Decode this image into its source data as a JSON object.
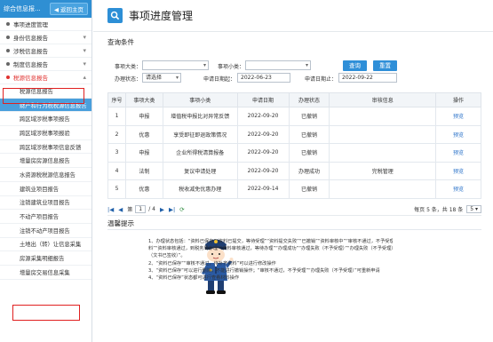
{
  "sidebar": {
    "title": "综合信息报...",
    "back_label": "返回主页",
    "groups": [
      {
        "label": "事项进度管理"
      },
      {
        "label": "身份信息报告"
      },
      {
        "label": "涉税信息报告"
      },
      {
        "label": "制度信息报告"
      }
    ],
    "active_group": {
      "label": "税源信息报告"
    },
    "sub_items": [
      {
        "label": "税源信息报告"
      },
      {
        "label": "财产和行为税税源信息报告"
      },
      {
        "label": "跨区域涉税事项报告"
      },
      {
        "label": "跨区域涉税事项报验"
      },
      {
        "label": "跨区域涉税事项信息反馈"
      },
      {
        "label": "增量房房源信息报告"
      },
      {
        "label": "水资源税税源信息报告"
      },
      {
        "label": "建筑业项目报告"
      },
      {
        "label": "注销建筑业项目报告"
      },
      {
        "label": "不动产项目报告"
      },
      {
        "label": "注销不动产项目报告"
      },
      {
        "label": "土地出（转）让信息采集"
      },
      {
        "label": "房源采集明细报告"
      },
      {
        "label": "增量房交易信息采集"
      }
    ]
  },
  "header": {
    "title": "事项进度管理"
  },
  "query": {
    "section_title": "查询条件",
    "item_type_label": "事项大类：",
    "item_type_value": "",
    "item_sub_label": "事项小类：",
    "item_sub_value": "",
    "status_label": "办理状态：",
    "status_value": "请选择",
    "date_start_label": "申请日期起：",
    "date_start_value": "2022-06-23",
    "date_end_label": "申请日期止：",
    "date_end_value": "2022-09-22",
    "search_label": "查询",
    "reset_label": "重置"
  },
  "table": {
    "headers": [
      "序号",
      "事项大类",
      "事项小类",
      "申请日期",
      "办理状态",
      "审核信息",
      "操作"
    ],
    "rows": [
      {
        "no": "1",
        "type": "申报",
        "sub": "增值税申报比对异常反馈",
        "date": "2022-09-20",
        "status": "已撤销",
        "review": "",
        "op": "预览"
      },
      {
        "no": "2",
        "type": "优惠",
        "sub": "享受即征即退政策情况",
        "date": "2022-09-20",
        "status": "已撤销",
        "review": "",
        "op": "预览"
      },
      {
        "no": "3",
        "type": "申报",
        "sub": "企业所得税清算报备",
        "date": "2022-09-20",
        "status": "已撤销",
        "review": "",
        "op": "预览"
      },
      {
        "no": "4",
        "type": "法制",
        "sub": "复议申请处理",
        "date": "2022-09-20",
        "status": "办理成功",
        "review": "完税管理",
        "op": "预览"
      },
      {
        "no": "5",
        "type": "优惠",
        "sub": "税收减免优惠办理",
        "date": "2022-09-14",
        "status": "已撤销",
        "review": "",
        "op": "预览"
      }
    ]
  },
  "pager": {
    "page_prefix": "第",
    "current_page": "1",
    "total_pages": "/ 4",
    "info": "每页 5 条，共 18 条",
    "page_size": "5"
  },
  "tips": {
    "title": "温馨提示",
    "lines": [
      "1、办理状态包括：“资料已保存”“资料已提交，等待受理”“资料提交失败”“已撤销”“资料审核中”“审核不通过，不予受理”“审核不通过，待补齐资",
      "料”“资料审核通过，到税务局办理”“资料审核通过，等待办理”“办理成功”“办理失败（不予受理）”“办理失败（不予受理）”“办理成功（文书待签收）”“办理成功",
      "（文书已签收）”。",
      "2、“资料已保存”“审核不通过，待补齐资料”可以进行修改操作",
      "3、“资料已保存”可以进行删除，不能进行撤销操作；“审核不通过，不予受理”“办理失败（不予受理）”可重新申请",
      "4、“资料已保存”状态都可进行查看材料操作"
    ]
  },
  "colors": {
    "accent": "#2f8fd8",
    "highlight": "#e02020"
  }
}
